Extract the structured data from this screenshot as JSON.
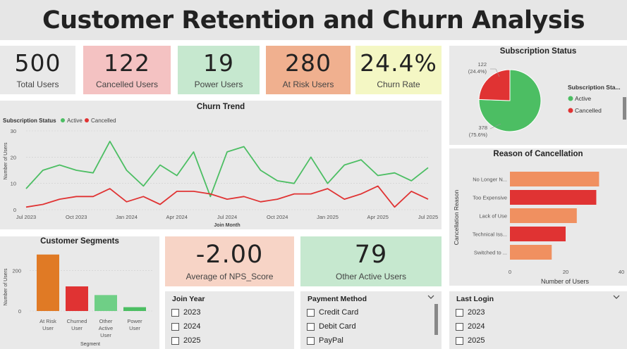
{
  "title": "Customer Retention and Churn Analysis",
  "kpis": {
    "total_users": {
      "value": "500",
      "label": "Total Users"
    },
    "cancelled_users": {
      "value": "122",
      "label": "Cancelled Users"
    },
    "power_users": {
      "value": "19",
      "label": "Power Users"
    },
    "at_risk_users": {
      "value": "280",
      "label": "At Risk Users"
    },
    "churn_rate": {
      "value": "24.4%",
      "label": "Churn Rate"
    },
    "nps": {
      "value": "-2.00",
      "label": "Average of NPS_Score"
    },
    "other_active": {
      "value": "79",
      "label": "Other Active Users"
    }
  },
  "colors": {
    "active": "#4cbe63",
    "cancelled": "#e03333",
    "orange": "#e07a25",
    "salmon": "#f09060"
  },
  "slicers": {
    "join_year": {
      "title": "Join Year",
      "items": [
        "2023",
        "2024",
        "2025"
      ]
    },
    "payment_method": {
      "title": "Payment Method",
      "items": [
        "Credit Card",
        "Debit Card",
        "PayPal"
      ]
    },
    "last_login": {
      "title": "Last Login",
      "items": [
        "2023",
        "2024",
        "2025"
      ]
    }
  },
  "chart_data": [
    {
      "type": "line",
      "title": "Churn Trend",
      "legend_title": "Subscription Status",
      "xlabel": "Join Month",
      "ylabel": "Number of Users",
      "ylim": [
        0,
        30
      ],
      "yticks": [
        0,
        10,
        20,
        30
      ],
      "x_tick_labels": [
        "Jul 2023",
        "Oct 2023",
        "Jan 2024",
        "Apr 2024",
        "Jul 2024",
        "Oct 2024",
        "Jan 2025",
        "Apr 2025",
        "Jul 2025"
      ],
      "grid": true,
      "legend_position": "top-left",
      "series": [
        {
          "name": "Active",
          "color": "#4cbe63",
          "values": [
            8,
            15,
            17,
            15,
            14,
            26,
            15,
            9,
            17,
            13,
            22,
            5,
            22,
            24,
            15,
            11,
            10,
            20,
            10,
            17,
            19,
            13,
            14,
            11,
            16
          ]
        },
        {
          "name": "Cancelled",
          "color": "#e03333",
          "values": [
            1,
            2,
            4,
            5,
            5,
            8,
            3,
            5,
            2,
            7,
            7,
            6,
            4,
            5,
            3,
            4,
            6,
            6,
            8,
            4,
            6,
            9,
            1,
            7,
            4
          ]
        }
      ]
    },
    {
      "type": "pie",
      "title": "Subscription Status",
      "legend_title": "Subscription Sta...",
      "legend_position": "right",
      "slices": [
        {
          "name": "Active",
          "value": 378,
          "label": "378",
          "pct_label": "(75.6%)",
          "color": "#4cbe63"
        },
        {
          "name": "Cancelled",
          "value": 122,
          "label": "122",
          "pct_label": "(24.4%)",
          "color": "#e03333"
        }
      ]
    },
    {
      "type": "bar",
      "title": "Customer Segments",
      "xlabel": "Segment",
      "ylabel": "Number of Users",
      "ylim": [
        0,
        300
      ],
      "yticks": [
        0,
        200
      ],
      "categories": [
        [
          "At Risk",
          "User"
        ],
        [
          "Churned",
          "User"
        ],
        [
          "Other",
          "Active",
          "User"
        ],
        [
          "Power",
          "User"
        ]
      ],
      "values": [
        280,
        122,
        79,
        19
      ],
      "colors": [
        "#e07a25",
        "#e03333",
        "#6fcf86",
        "#4cbe63"
      ]
    },
    {
      "type": "bar",
      "orientation": "horizontal",
      "title": "Reason of Cancellation",
      "xlabel": "Number of Users",
      "ylabel": "Cancellation Reason",
      "xlim": [
        0,
        40
      ],
      "xticks": [
        0,
        20,
        40
      ],
      "categories": [
        "No Longer N...",
        "Too Expensive",
        "Lack of Use",
        "Technical Iss...",
        "Switched to ..."
      ],
      "values": [
        32,
        31,
        24,
        20,
        15
      ],
      "colors": [
        "#f09060",
        "#e03333",
        "#f09060",
        "#e03333",
        "#f09060"
      ]
    }
  ]
}
